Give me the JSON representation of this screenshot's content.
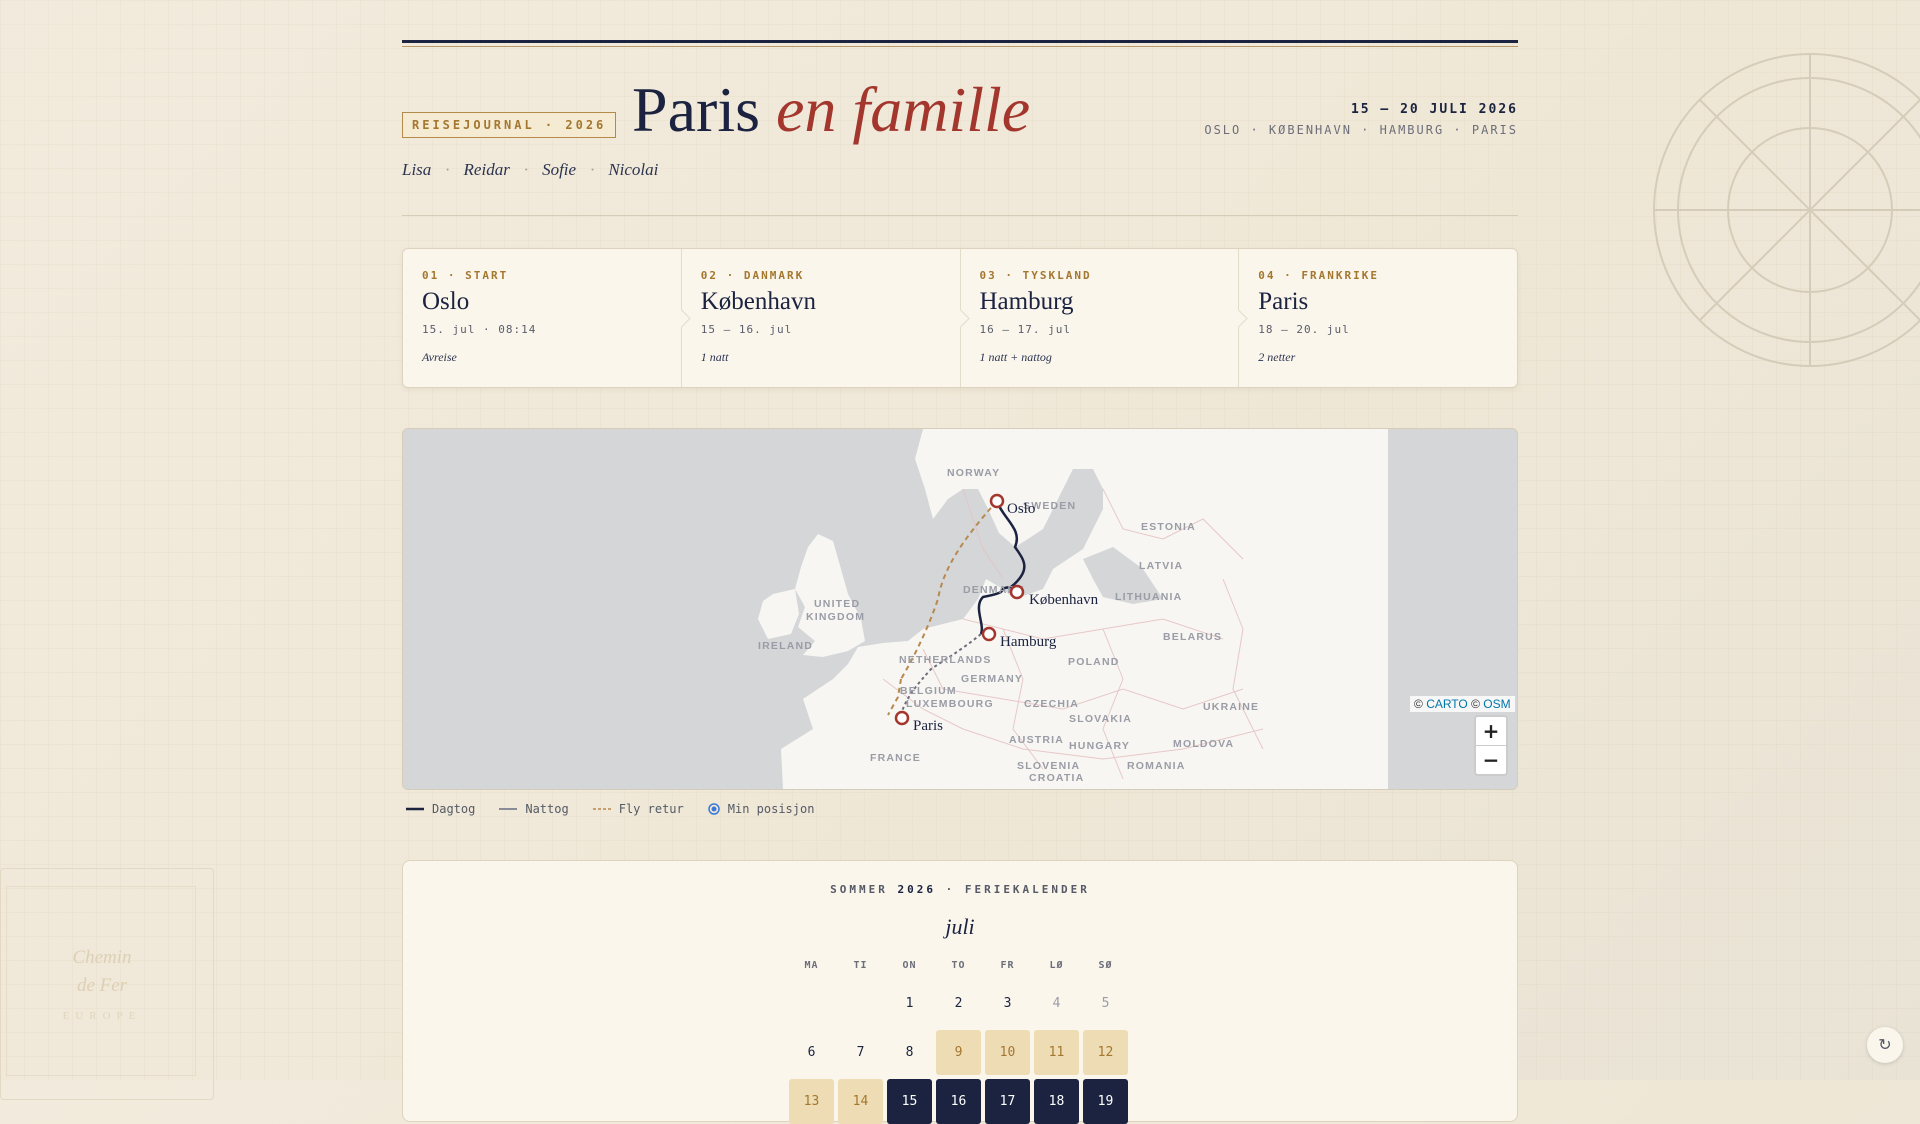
{
  "header": {
    "badge": "REISEJOURNAL · 2026",
    "title_plain": "Paris",
    "title_accent": "en famille",
    "dates": "15 — 20 JULI 2026",
    "route": "OSLO · KØBENHAVN · HAMBURG · PARIS",
    "travellers": [
      "Lisa",
      "Reidar",
      "Sofie",
      "Nicolai"
    ]
  },
  "stops": [
    {
      "tag": "01 · START",
      "name": "Oslo",
      "date": "15. jul · 08:14",
      "note": "Avreise"
    },
    {
      "tag": "02 · DANMARK",
      "name": "København",
      "date": "15 — 16. jul",
      "note": "1 natt"
    },
    {
      "tag": "03 · TYSKLAND",
      "name": "Hamburg",
      "date": "16 — 17. jul",
      "note": "1 natt + nattog"
    },
    {
      "tag": "04 · FRANKRIKE",
      "name": "Paris",
      "date": "18 — 20. jul",
      "note": "2 netter"
    }
  ],
  "map": {
    "cities": [
      "Oslo",
      "København",
      "Hamburg",
      "Paris"
    ],
    "countries": [
      "NORWAY",
      "SWEDEN",
      "ESTONIA",
      "LATVIA",
      "LITHUANIA",
      "DENMARK",
      "UNITED",
      "KINGDOM",
      "IRELAND",
      "NETHERLANDS",
      "BELGIUM",
      "LUXEMBOURG",
      "GERMANY",
      "POLAND",
      "BELARUS",
      "CZECHIA",
      "SLOVAKIA",
      "UKRAINE",
      "AUSTRIA",
      "HUNGARY",
      "MOLDOVA",
      "SLOVENIA",
      "CROATIA",
      "ROMANIA",
      "FRANCE"
    ],
    "attribution_prefix": "©",
    "attribution_carto": "CARTO",
    "attribution_mid": "©",
    "attribution_osm": "OSM",
    "zoom_in": "+",
    "zoom_out": "−",
    "colors": {
      "day_train": "#1b2340",
      "night_train": "#6c6e7a",
      "flight": "#b8894e",
      "marker": "#a3362d"
    }
  },
  "legend": [
    {
      "label": "Dagtog",
      "icon": "solid-line-icon"
    },
    {
      "label": "Nattog",
      "icon": "gray-line-icon"
    },
    {
      "label": "Fly retur",
      "icon": "dashed-line-icon"
    },
    {
      "label": "Min posisjon",
      "icon": "location-dot-icon"
    }
  ],
  "calendar": {
    "head_left": "SOMMER",
    "head_year": "2026",
    "head_right": "· FERIEKALENDER",
    "month": "juli",
    "weekdays": [
      "MA",
      "TI",
      "ON",
      "TO",
      "FR",
      "LØ",
      "SØ"
    ],
    "rows": [
      [
        "",
        "",
        "1",
        "2",
        "3",
        "4",
        "5"
      ],
      [
        "6",
        "7",
        "8",
        "9",
        "10",
        "11",
        "12"
      ],
      [
        "13",
        "14",
        "15",
        "16",
        "17",
        "18",
        "19"
      ]
    ]
  },
  "stamp": {
    "line1": "Chemin",
    "line2": "de Fer",
    "sub": "EUROPE"
  },
  "refresh_icon": "↻"
}
